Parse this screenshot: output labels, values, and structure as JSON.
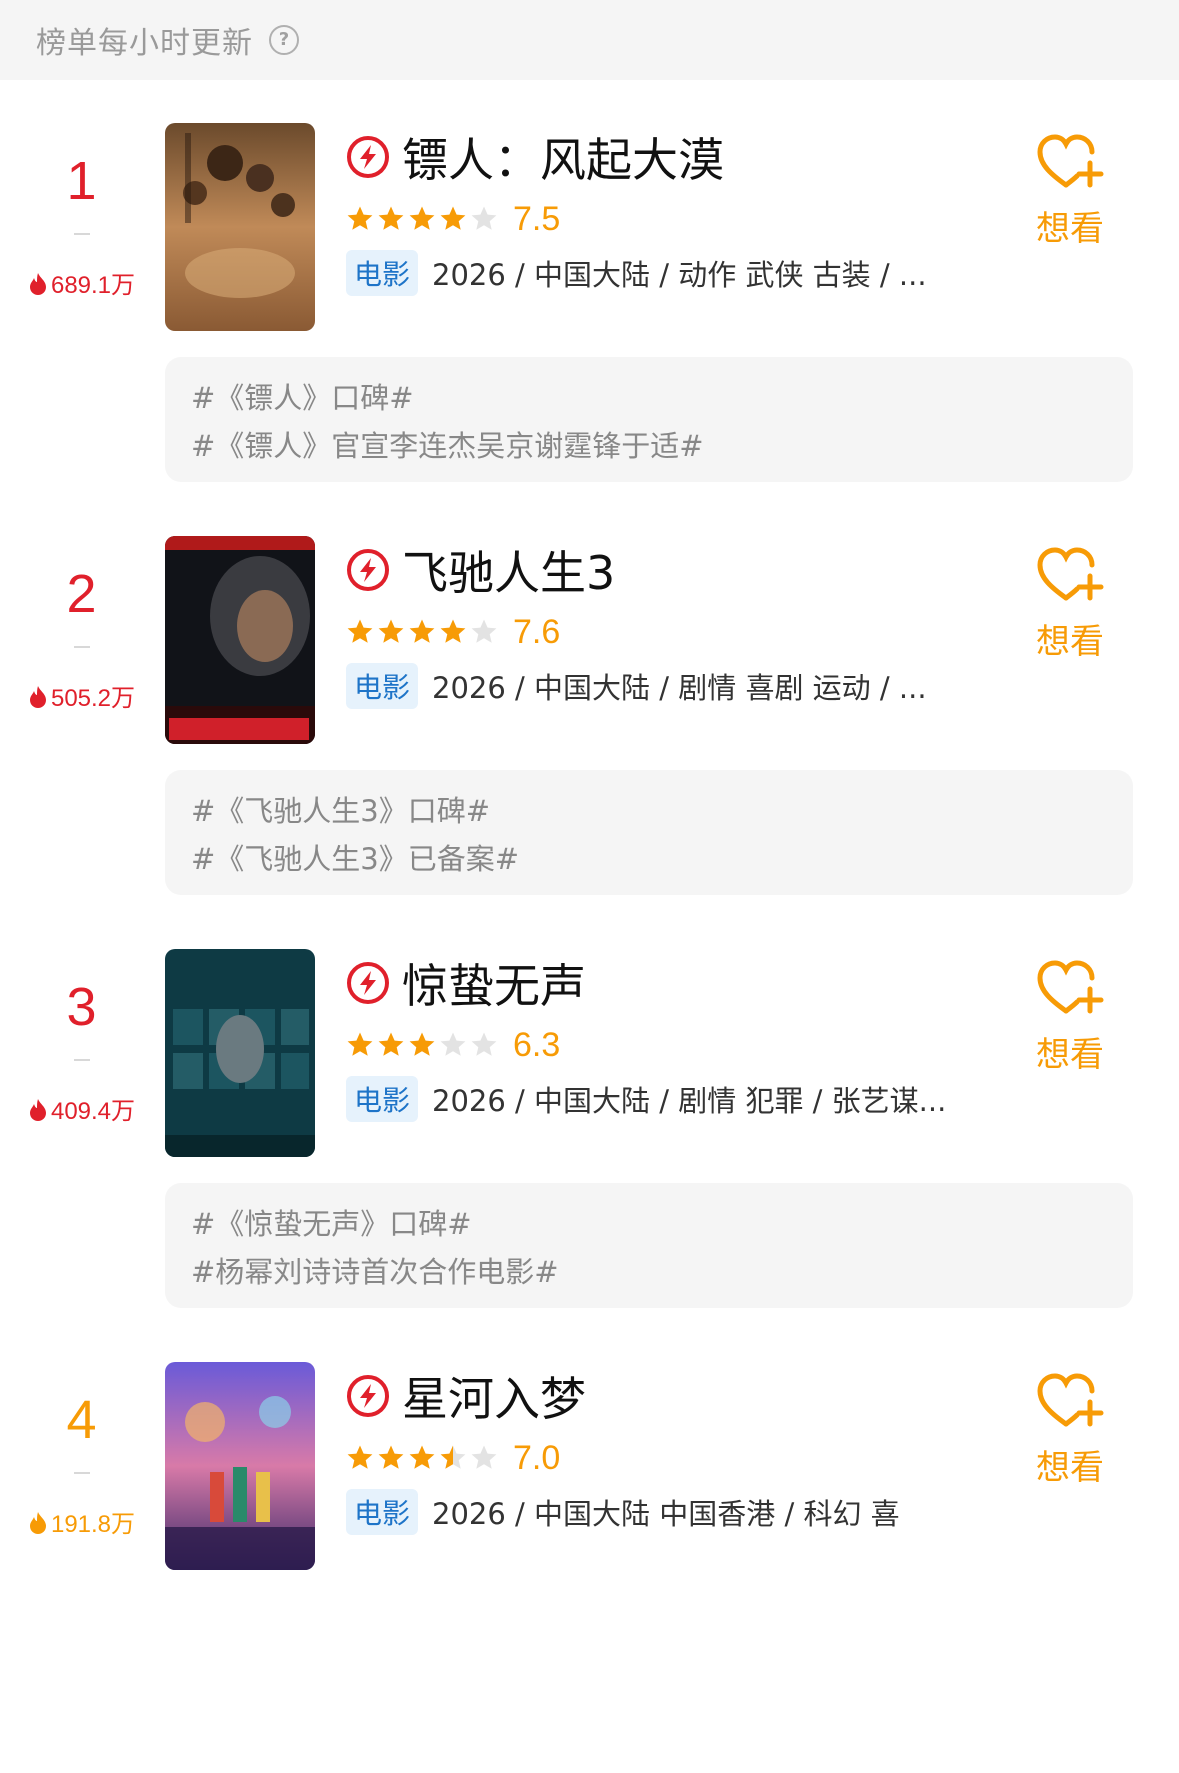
{
  "header": {
    "update_note": "榜单每小时更新",
    "help_icon": "question-circle-icon"
  },
  "colors": {
    "rank_red": "#e0202b",
    "rank_orange": "#f79b06",
    "star": "#f79b06",
    "tag_bg": "#e6f2fc",
    "tag_text": "#1e74c8"
  },
  "items": [
    {
      "rank": "1",
      "heat": "689.1万",
      "title": "镖人：风起大漠",
      "rating": 7.5,
      "rating_text": "7.5",
      "type": "电影",
      "meta": "2026 / 中国大陆 / 动作 武侠 古装 / ...",
      "want_label": "想看",
      "topics": [
        "#《镖人》口碑#",
        "#《镖人》官宣李连杰吴京谢霆锋于适#"
      ]
    },
    {
      "rank": "2",
      "heat": "505.2万",
      "title": "飞驰人生3",
      "rating": 7.6,
      "rating_text": "7.6",
      "type": "电影",
      "meta": "2026 / 中国大陆 / 剧情 喜剧 运动 / ...",
      "want_label": "想看",
      "topics": [
        "#《飞驰人生3》口碑#",
        "#《飞驰人生3》已备案#"
      ]
    },
    {
      "rank": "3",
      "heat": "409.4万",
      "title": "惊蛰无声",
      "rating": 6.3,
      "rating_text": "6.3",
      "type": "电影",
      "meta": "2026 / 中国大陆 / 剧情 犯罪 / 张艺谋...",
      "want_label": "想看",
      "topics": [
        "#《惊蛰无声》口碑#",
        "#杨幂刘诗诗首次合作电影#"
      ]
    },
    {
      "rank": "4",
      "heat": "191.8万",
      "title": "星河入梦",
      "rating": 7.0,
      "rating_text": "7.0",
      "type": "电影",
      "meta": "2026 / 中国大陆 中国香港 / 科幻 喜",
      "want_label": "想看",
      "topics": []
    }
  ]
}
